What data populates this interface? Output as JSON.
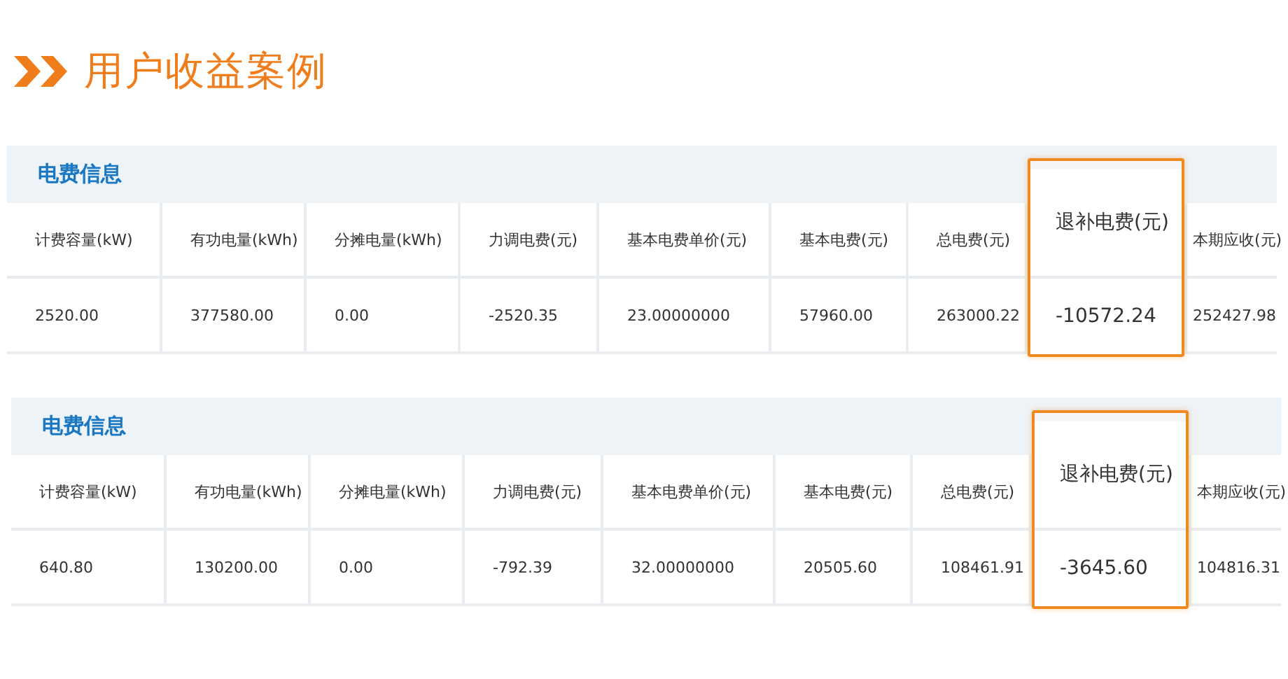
{
  "title": "用户收益案例",
  "panels": [
    {
      "title": "电费信息",
      "columns": [
        {
          "header": "计费容量(kW)",
          "value": "2520.00",
          "highlighted": false
        },
        {
          "header": "有功电量(kWh)",
          "value": "377580.00",
          "highlighted": false
        },
        {
          "header": "分摊电量(kWh)",
          "value": "0.00",
          "highlighted": false
        },
        {
          "header": "力调电费(元)",
          "value": "-2520.35",
          "highlighted": false
        },
        {
          "header": "基本电费单价(元)",
          "value": "23.00000000",
          "highlighted": false
        },
        {
          "header": "基本电费(元)",
          "value": "57960.00",
          "highlighted": false
        },
        {
          "header": "总电费(元)",
          "value": "263000.22",
          "highlighted": false
        },
        {
          "header": "退补电费(元)",
          "value": "-10572.24",
          "highlighted": true
        },
        {
          "header": "本期应收(元)",
          "value": "252427.98",
          "highlighted": false
        }
      ]
    },
    {
      "title": "电费信息",
      "columns": [
        {
          "header": "计费容量(kW)",
          "value": "640.80",
          "highlighted": false
        },
        {
          "header": "有功电量(kWh)",
          "value": "130200.00",
          "highlighted": false
        },
        {
          "header": "分摊电量(kWh)",
          "value": "0.00",
          "highlighted": false
        },
        {
          "header": "力调电费(元)",
          "value": "-792.39",
          "highlighted": false
        },
        {
          "header": "基本电费单价(元)",
          "value": "32.00000000",
          "highlighted": false
        },
        {
          "header": "基本电费(元)",
          "value": "20505.60",
          "highlighted": false
        },
        {
          "header": "总电费(元)",
          "value": "108461.91",
          "highlighted": false
        },
        {
          "header": "退补电费(元)",
          "value": "-3645.60",
          "highlighted": true
        },
        {
          "header": "本期应收(元)",
          "value": "104816.31",
          "highlighted": false
        }
      ]
    }
  ]
}
